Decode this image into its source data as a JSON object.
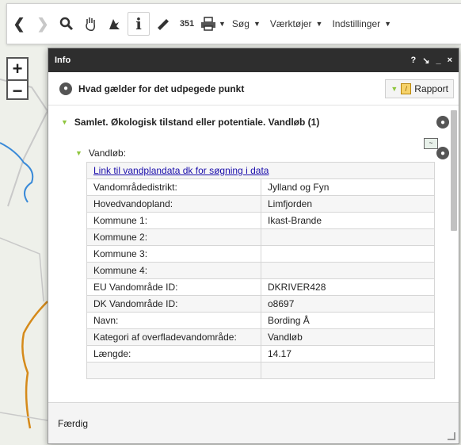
{
  "toolbar": {
    "back_icon": "chevron-left-icon",
    "forward_icon": "chevron-right-icon",
    "search_icon": "magnifier-icon",
    "pan_icon": "hand-icon",
    "identify_icon": "pointer-icon",
    "info_label": "i",
    "measure_icon": "ruler-icon",
    "scale_label": "351",
    "print_icon": "printer-icon",
    "menus": [
      {
        "label": "Søg"
      },
      {
        "label": "Værktøjer"
      },
      {
        "label": "Indstillinger"
      }
    ]
  },
  "zoom": {
    "in": "+",
    "out": "−"
  },
  "panel": {
    "title": "Info",
    "controls": [
      "?",
      "↘",
      "_",
      "×"
    ],
    "subtitle": "Hvad gælder for det udpegede punkt",
    "rapport_label": "Rapport",
    "section_title": "Samlet. Økologisk tilstand eller potentiale. Vandløb (1)",
    "subsection_label": "Vandløb:",
    "link_text": "Link til vandplandata dk for søgning i data",
    "rows": [
      {
        "key": "Vandområdedistrikt:",
        "value": "Jylland og Fyn"
      },
      {
        "key": "Hovedvandopland:",
        "value": "Limfjorden"
      },
      {
        "key": "Kommune 1:",
        "value": "Ikast-Brande"
      },
      {
        "key": "Kommune 2:",
        "value": ""
      },
      {
        "key": "Kommune 3:",
        "value": ""
      },
      {
        "key": "Kommune 4:",
        "value": ""
      },
      {
        "key": "EU Vandområde ID:",
        "value": "DKRIVER428"
      },
      {
        "key": "DK Vandområde ID:",
        "value": "o8697"
      },
      {
        "key": "Navn:",
        "value": "Bording Å"
      },
      {
        "key": "Kategori af overfladevandområde:",
        "value": "Vandløb"
      },
      {
        "key": "Længde:",
        "value": "14.17"
      }
    ],
    "footer_label": "Færdig"
  }
}
